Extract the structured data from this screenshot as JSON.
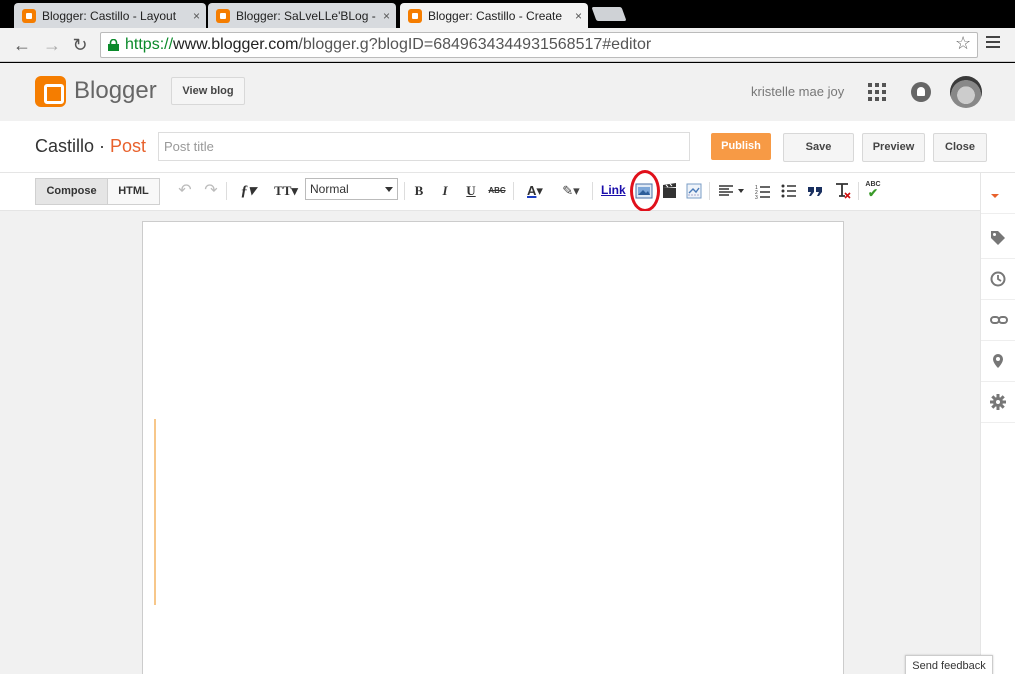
{
  "tabs": [
    {
      "label": "Blogger: Castillo - Layout",
      "close": "×"
    },
    {
      "label": "Blogger: SaLveLLe'BLog -",
      "close": "×"
    },
    {
      "label": "Blogger: Castillo - Create",
      "close": "×"
    }
  ],
  "url": {
    "scheme": "https://",
    "domain": "www.blogger.com",
    "path": "/blogger.g?blogID=6849634344931568517#editor"
  },
  "header": {
    "brand": "Blogger",
    "view_blog": "View blog",
    "user": "kristelle mae joy"
  },
  "post": {
    "blog_name": "Castillo",
    "separator": " · ",
    "section": "Post",
    "title_placeholder": "Post title",
    "publish": "Publish",
    "save": "Save",
    "preview": "Preview",
    "close": "Close"
  },
  "editor": {
    "compose": "Compose",
    "html": "HTML",
    "format": "Normal",
    "bold": "B",
    "italic": "I",
    "underline": "U",
    "strike": "ABC",
    "link": "Link",
    "spell": "ABC"
  },
  "feedback": "Send feedback",
  "colors": {
    "brand": "#f57d00",
    "publish": "#f79a45",
    "highlight": "#e0101b"
  }
}
